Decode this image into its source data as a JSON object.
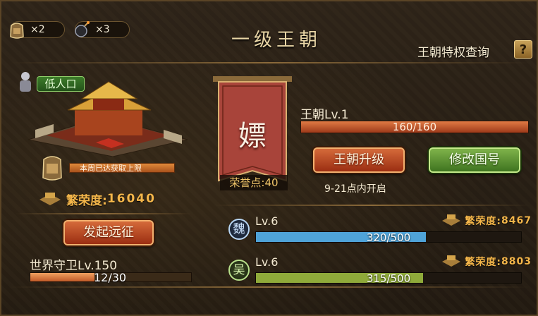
{
  "resources": [
    {
      "icon": "expedition-token-icon",
      "count": "×2"
    },
    {
      "icon": "bomb-icon",
      "count": "×3"
    }
  ],
  "title": "一级王朝",
  "privilege_query": "王朝特权查询",
  "help_label": "?",
  "city": {
    "population_tag": "低人口",
    "weekly_limit": "本周已达获取上限",
    "prosperity_label": "繁荣度:",
    "prosperity_value": "16040"
  },
  "expedition_button": "发起远征",
  "world_guard": {
    "label": "世界守卫Lv.150",
    "progress_text": "12/30",
    "progress": 0.4
  },
  "banner": {
    "character": "嫖",
    "honor": "荣誉点:40"
  },
  "dynasty": {
    "level_label": "王朝Lv.1",
    "progress_text": "160/160",
    "progress": 1.0,
    "upgrade_button": "王朝升级",
    "rename_button": "修改国号",
    "open_note": "9-21点内开启"
  },
  "kingdoms": [
    {
      "emblem": "魏",
      "level": "Lv.6",
      "progress_text": "320/500",
      "progress": 0.64,
      "prosperity_label": "繁荣度:",
      "prosperity_value": "8467",
      "color": "#4fa3d8"
    },
    {
      "emblem": "吴",
      "level": "Lv.6",
      "progress_text": "315/500",
      "progress": 0.63,
      "prosperity_label": "繁荣度:",
      "prosperity_value": "8803",
      "color": "#8faa3a"
    }
  ]
}
